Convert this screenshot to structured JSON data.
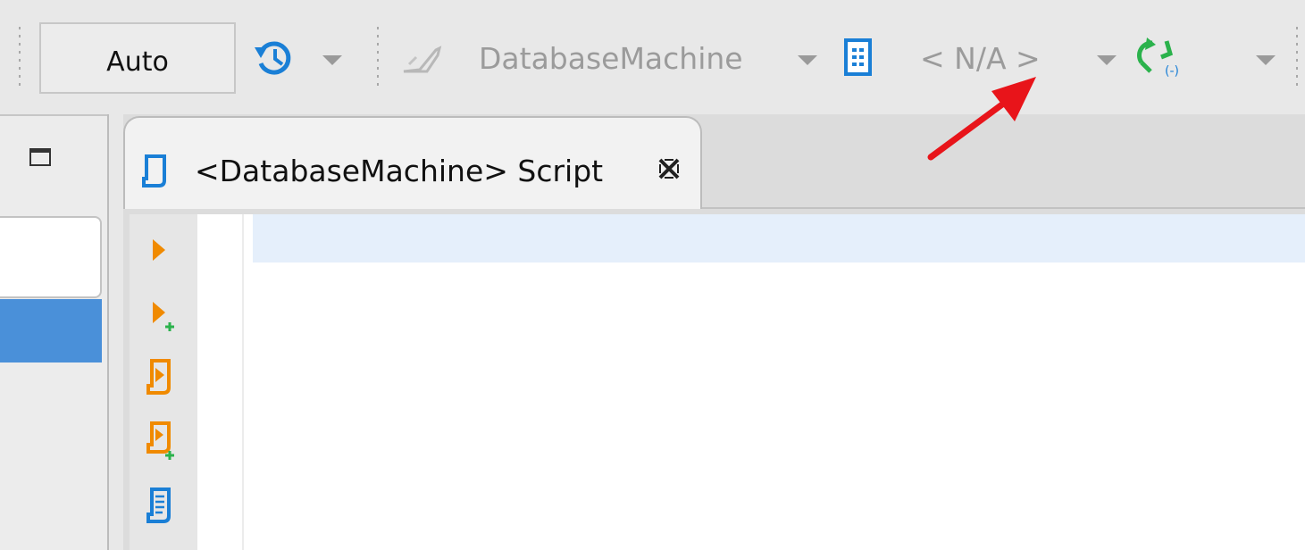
{
  "toolbar": {
    "commit_mode": "Auto",
    "connection_name": "DatabaseMachine",
    "schema_name": "< N/A >"
  },
  "editor": {
    "tab_title": "<DatabaseMachine> Script"
  },
  "icons": {
    "history": "history-icon",
    "connection": "database-connection-icon",
    "schema": "schema-icon",
    "transaction": "transaction-mode-icon",
    "execute": "execute-statement-icon",
    "execute_new_tab": "execute-in-new-tab-icon",
    "execute_script": "execute-script-icon",
    "execute_script_new_tab": "execute-script-new-tab-icon",
    "explain": "explain-plan-icon"
  },
  "colors": {
    "accent_blue": "#1a7fd6",
    "execute_orange": "#f08a00",
    "transaction_green": "#2bb24c",
    "selection_blue": "#4a90d9",
    "annotation_red": "#e8141a"
  }
}
